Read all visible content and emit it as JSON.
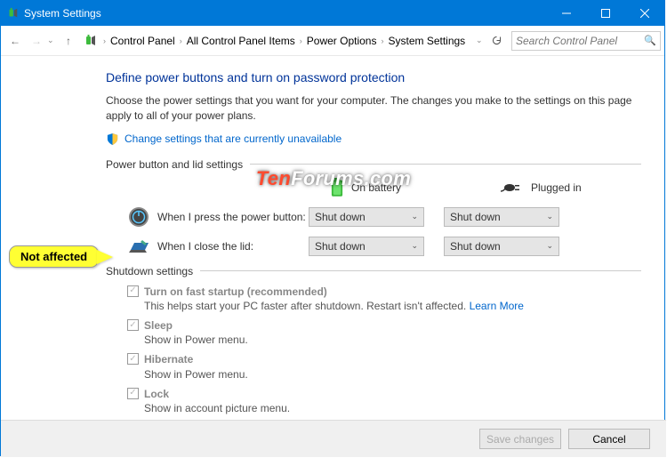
{
  "window": {
    "title": "System Settings"
  },
  "breadcrumb": {
    "items": [
      "Control Panel",
      "All Control Panel Items",
      "Power Options",
      "System Settings"
    ]
  },
  "search": {
    "placeholder": "Search Control Panel"
  },
  "page": {
    "heading": "Define power buttons and turn on password protection",
    "description": "Choose the power settings that you want for your computer. The changes you make to the settings on this page apply to all of your power plans.",
    "change_link": "Change settings that are currently unavailable"
  },
  "sections": {
    "power_button": "Power button and lid settings",
    "shutdown": "Shutdown settings"
  },
  "columns": {
    "battery": "On battery",
    "plugged": "Plugged in"
  },
  "rows": {
    "power_button": {
      "label": "When I press the power button:",
      "battery": "Shut down",
      "plugged": "Shut down"
    },
    "lid": {
      "label": "When I close the lid:",
      "battery": "Shut down",
      "plugged": "Shut down"
    }
  },
  "shutdown_opts": {
    "fast": {
      "title": "Turn on fast startup (recommended)",
      "sub": "This helps start your PC faster after shutdown. Restart isn't affected.",
      "link": "Learn More"
    },
    "sleep": {
      "title": "Sleep",
      "sub": "Show in Power menu."
    },
    "hibernate": {
      "title": "Hibernate",
      "sub": "Show in Power menu."
    },
    "lock": {
      "title": "Lock",
      "sub": "Show in account picture menu."
    }
  },
  "buttons": {
    "save": "Save changes",
    "cancel": "Cancel"
  },
  "callout": "Not affected",
  "watermark": {
    "a": "Ten",
    "b": "Forums",
    "c": ".com"
  }
}
